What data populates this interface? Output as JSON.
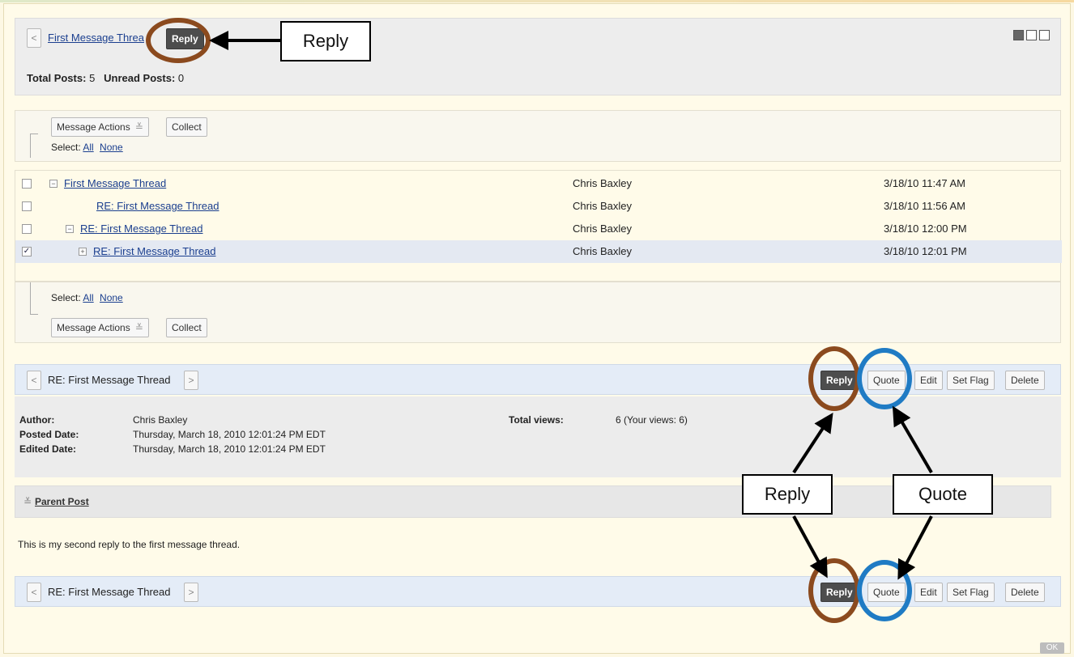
{
  "header": {
    "prev_label": "<",
    "thread_title": "First Message Threa",
    "reply_label": "Reply",
    "total_posts_label": "Total Posts:",
    "total_posts_value": "5",
    "unread_posts_label": "Unread Posts:",
    "unread_posts_value": "0"
  },
  "actions_top": {
    "message_actions_label": "Message Actions",
    "dropdown_glyph": "≚",
    "collect_label": "Collect",
    "select_label": "Select:",
    "all_label": "All",
    "none_label": "None"
  },
  "messages": [
    {
      "expander": "⊟",
      "subject": "First Message Thread",
      "author": "Chris Baxley",
      "date": "3/18/10 11:47 AM",
      "checked": false
    },
    {
      "expander": "",
      "subject": "RE: First Message Thread",
      "author": "Chris Baxley",
      "date": "3/18/10 11:56 AM",
      "checked": false
    },
    {
      "expander": "⊟",
      "subject": "RE: First Message Thread",
      "author": "Chris Baxley",
      "date": "3/18/10 12:00 PM",
      "checked": false
    },
    {
      "expander": "⊞",
      "subject": "RE: First Message Thread",
      "author": "Chris Baxley",
      "date": "3/18/10 12:01 PM",
      "checked": true
    }
  ],
  "actions_bottom": {
    "select_label": "Select:",
    "all_label": "All",
    "none_label": "None",
    "message_actions_label": "Message Actions",
    "dropdown_glyph": "≚",
    "collect_label": "Collect"
  },
  "post": {
    "title": "RE: First Message Thread",
    "prev_label": "<",
    "next_label": ">",
    "buttons": {
      "reply": "Reply",
      "quote": "Quote",
      "edit": "Edit",
      "set_flag": "Set Flag",
      "delete": "Delete"
    },
    "author_label": "Author:",
    "author_value": "Chris Baxley",
    "posted_label": "Posted Date:",
    "posted_value": "Thursday, March 18, 2010 12:01:24 PM EDT",
    "edited_label": "Edited Date:",
    "edited_value": "Thursday, March 18, 2010 12:01:24 PM EDT",
    "views_label": "Total views:",
    "views_value": "6 (Your views: 6)",
    "parent_post_glyph": "≚",
    "parent_post_label": "Parent Post",
    "body": "This is my second reply to the first message thread."
  },
  "annotations": {
    "top_callout": "Reply",
    "reply_callout": "Reply",
    "quote_callout": "Quote",
    "ring_brown": "#8b4a1e",
    "ring_blue": "#1f7bc4"
  },
  "footer": {
    "ok_label": "OK"
  }
}
